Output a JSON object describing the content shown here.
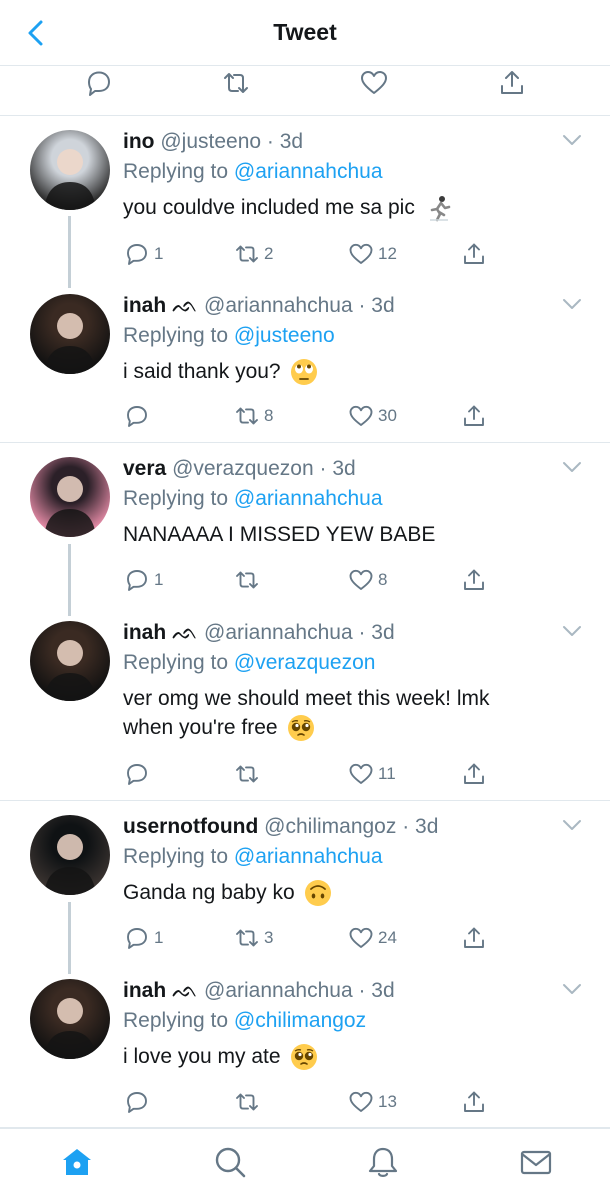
{
  "header": {
    "title": "Tweet"
  },
  "tweets": [
    {
      "name": "ino",
      "badge": "",
      "handle": "@justeeno",
      "time": "3d",
      "replying_prefix": "Replying to ",
      "replying_to": "@ariannahchua",
      "text": "you couldve included me sa pic",
      "emoji": "running-figure",
      "replies": "1",
      "retweets": "2",
      "likes": "12"
    },
    {
      "name": "inah",
      "badge": "ᨒ",
      "handle": "@ariannahchua",
      "time": "3d",
      "replying_prefix": "Replying to ",
      "replying_to": "@justeeno",
      "text": "i said thank you?",
      "emoji": "eye-roll",
      "replies": "",
      "retweets": "8",
      "likes": "30"
    },
    {
      "name": "vera",
      "badge": "",
      "handle": "@verazquezon",
      "time": "3d",
      "replying_prefix": "Replying to ",
      "replying_to": "@ariannahchua",
      "text": "NANAAAA I MISSED YEW BABE",
      "emoji": "",
      "replies": "1",
      "retweets": "",
      "likes": "8"
    },
    {
      "name": "inah",
      "badge": "ᨒ",
      "handle": "@ariannahchua",
      "time": "3d",
      "replying_prefix": "Replying to ",
      "replying_to": "@verazquezon",
      "text_line1": "ver omg we should meet this week! lmk",
      "text_line2": "when you're free",
      "emoji": "pleading",
      "replies": "",
      "retweets": "",
      "likes": "11"
    },
    {
      "name": "usernotfound",
      "badge": "",
      "handle": "@chilimangoz",
      "time": "3d",
      "replying_prefix": "Replying to ",
      "replying_to": "@ariannahchua",
      "text": "Ganda ng baby ko",
      "emoji": "upside-down-face",
      "replies": "1",
      "retweets": "3",
      "likes": "24"
    },
    {
      "name": "inah",
      "badge": "ᨒ",
      "handle": "@ariannahchua",
      "time": "3d",
      "replying_prefix": "Replying to ",
      "replying_to": "@chilimangoz",
      "text": "i love you my ate",
      "emoji": "pleading",
      "replies": "",
      "retweets": "",
      "likes": "13"
    }
  ],
  "colors": {
    "accent": "#1da1f2",
    "secondary_text": "#657786",
    "icon": "#657786",
    "divider": "#e1e8ed"
  }
}
